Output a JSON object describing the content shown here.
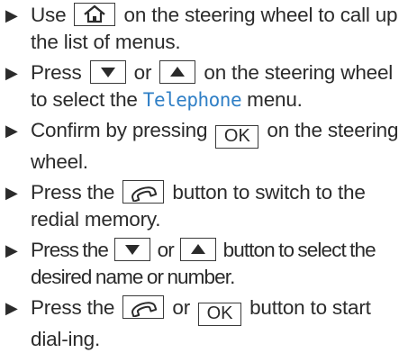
{
  "steps": [
    {
      "before": "Use",
      "key1": "home-icon",
      "after": "on the steering wheel to call up the list of menus."
    },
    {
      "before": "Press",
      "key1": "down-arrow-icon",
      "middle": "or",
      "key2": "up-arrow-icon",
      "after": "on the steering wheel to select the",
      "menu_name": "Telephone",
      "end": "menu."
    },
    {
      "before": "Confirm by pressing",
      "key1_label": "OK",
      "after": "on the steering wheel."
    },
    {
      "before": "Press the",
      "key1": "phone-icon",
      "after": "button to switch to the redial memory."
    },
    {
      "before": "Press the",
      "key1": "down-arrow-icon",
      "middle": "or",
      "key2": "up-arrow-icon",
      "after": "button to select the desired name or number."
    },
    {
      "before": "Press the",
      "key1": "phone-icon",
      "middle": "or",
      "key2_label": "OK",
      "after": "button to start dial-ing."
    }
  ],
  "colors": {
    "text": "#2b2b2b",
    "menu_name": "#2f7fc6",
    "key_border": "#3a3a3a"
  }
}
